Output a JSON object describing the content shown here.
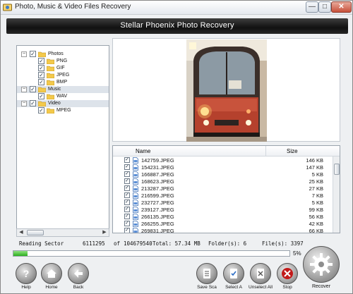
{
  "window": {
    "title": "Photo, Music & Video Files Recovery",
    "controls": {
      "minimize": "—",
      "maximize": "□",
      "close": "✕"
    }
  },
  "banner": {
    "title": "Stellar Phoenix Photo Recovery"
  },
  "tree": {
    "items": [
      {
        "label": "Photos",
        "level": 0,
        "expander": "−",
        "checked": "✓",
        "selected": false
      },
      {
        "label": "PNG",
        "level": 1,
        "checked": "✓"
      },
      {
        "label": "GIF",
        "level": 1,
        "checked": "✓"
      },
      {
        "label": "JPEG",
        "level": 1,
        "checked": "✓"
      },
      {
        "label": "BMP",
        "level": 1,
        "checked": "✓"
      },
      {
        "label": "Music",
        "level": 0,
        "expander": "−",
        "checked": "✓",
        "selected": true
      },
      {
        "label": "WAV",
        "level": 1,
        "checked": "✓"
      },
      {
        "label": "Video",
        "level": 0,
        "expander": "−",
        "checked": "✓",
        "selected": true
      },
      {
        "label": "MPEG",
        "level": 1,
        "checked": "✓"
      }
    ],
    "scroll_left": "◀",
    "scroll_right": "▶"
  },
  "file_list": {
    "columns": {
      "name": "Name",
      "size": "Size"
    },
    "rows": [
      {
        "name": "142759.JPEG",
        "size": "146 KB"
      },
      {
        "name": "154231.JPEG",
        "size": "147 KB"
      },
      {
        "name": "166887.JPEG",
        "size": "5 KB"
      },
      {
        "name": "168623.JPEG",
        "size": "25 KB"
      },
      {
        "name": "213287.JPEG",
        "size": "27 KB"
      },
      {
        "name": "216599.JPEG",
        "size": "7 KB"
      },
      {
        "name": "232727.JPEG",
        "size": "5 KB"
      },
      {
        "name": "239127.JPEG",
        "size": "99 KB"
      },
      {
        "name": "266135.JPEG",
        "size": "56 KB"
      },
      {
        "name": "266255.JPEG",
        "size": "42 KB"
      },
      {
        "name": "269831.JPEG",
        "size": "66 KB"
      }
    ],
    "check_mark": "✓"
  },
  "status": {
    "reading_label": "Reading Sector",
    "sector_current": "6111295",
    "of_label": "of",
    "sector_total": "104679540",
    "total_label": "Total: 57.34 MB",
    "folders_label": "Folder(s): 6",
    "files_label": "File(s): 3397"
  },
  "progress": {
    "percent": 5,
    "percent_text": "5%"
  },
  "toolbar": {
    "help": "Help",
    "home": "Home",
    "back": "Back",
    "save_scan": "Save Sca",
    "select_all": "Select A",
    "unselect_all": "Unselect All",
    "stop": "Stop",
    "recover": "Recover"
  },
  "colors": {
    "banner_bg": "#1a1a1a",
    "progress_green": "#2bae1e",
    "stop_red": "#c21a1a"
  }
}
